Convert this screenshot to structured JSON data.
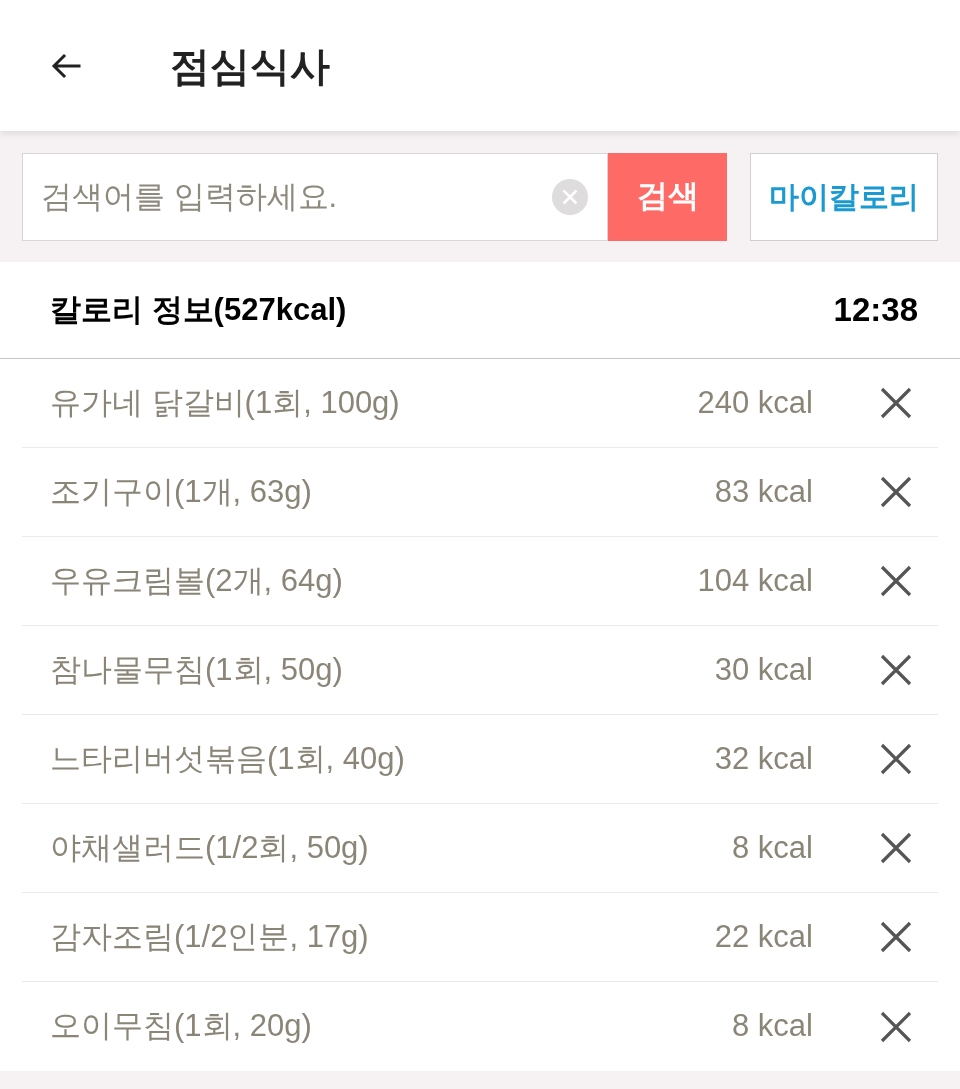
{
  "header": {
    "title": "점심식사"
  },
  "search": {
    "placeholder": "검색어를 입력하세요.",
    "search_button": "검색",
    "my_calorie_button": "마이칼로리"
  },
  "calorie_info": {
    "title": "칼로리 정보(527kcal)",
    "time": "12:38"
  },
  "food_items": [
    {
      "name": "유가네 닭갈비(1회, 100g)",
      "calories": "240 kcal"
    },
    {
      "name": "조기구이(1개, 63g)",
      "calories": "83 kcal"
    },
    {
      "name": "우유크림볼(2개, 64g)",
      "calories": "104 kcal"
    },
    {
      "name": "참나물무침(1회, 50g)",
      "calories": "30 kcal"
    },
    {
      "name": "느타리버섯볶음(1회, 40g)",
      "calories": "32 kcal"
    },
    {
      "name": "야채샐러드(1/2회, 50g)",
      "calories": "8 kcal"
    },
    {
      "name": "감자조림(1/2인분, 17g)",
      "calories": "22 kcal"
    },
    {
      "name": "오이무침(1회, 20g)",
      "calories": "8 kcal"
    }
  ]
}
